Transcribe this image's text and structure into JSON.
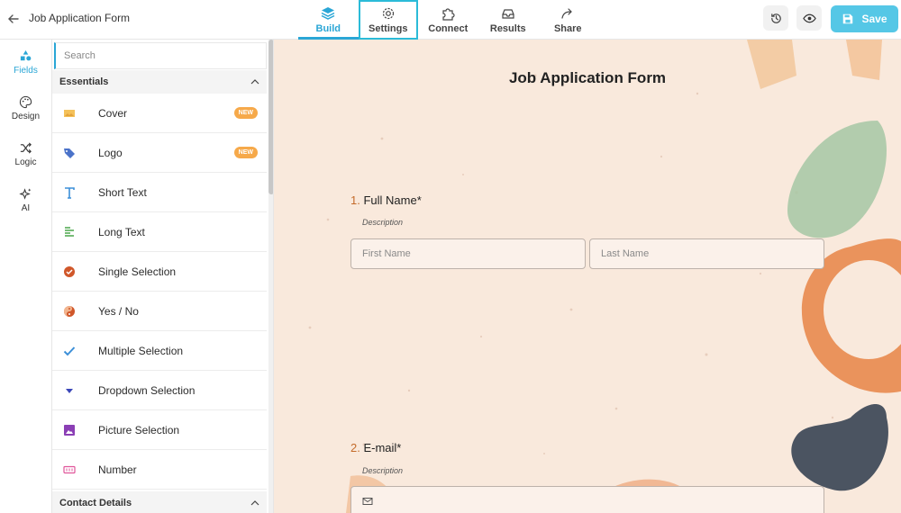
{
  "header": {
    "title": "Job Application Form",
    "tabs": [
      {
        "label": "Build",
        "icon": "layers-icon"
      },
      {
        "label": "Settings",
        "icon": "gear-icon"
      },
      {
        "label": "Connect",
        "icon": "puzzle-icon"
      },
      {
        "label": "Results",
        "icon": "inbox-icon"
      },
      {
        "label": "Share",
        "icon": "share-icon"
      }
    ],
    "save_label": "Save",
    "accent": "#2aa6d6",
    "save_color": "#55c7e6"
  },
  "rail": [
    {
      "label": "Fields",
      "icon": "shapes-icon"
    },
    {
      "label": "Design",
      "icon": "palette-icon"
    },
    {
      "label": "Logic",
      "icon": "shuffle-icon"
    },
    {
      "label": "AI",
      "icon": "sparkle-icon"
    }
  ],
  "panel": {
    "search_placeholder": "Search",
    "section_essentials": "Essentials",
    "section_contact": "Contact Details",
    "items": [
      {
        "label": "Cover",
        "badge": "NEW",
        "icon": "image-icon"
      },
      {
        "label": "Logo",
        "badge": "NEW",
        "icon": "tag-icon"
      },
      {
        "label": "Short Text",
        "icon": "text-icon"
      },
      {
        "label": "Long Text",
        "icon": "paragraph-icon"
      },
      {
        "label": "Single Selection",
        "icon": "check-circle-icon"
      },
      {
        "label": "Yes / No",
        "icon": "yes-no-icon"
      },
      {
        "label": "Multiple Selection",
        "icon": "checkmark-icon"
      },
      {
        "label": "Dropdown Selection",
        "icon": "caret-down-icon"
      },
      {
        "label": "Picture Selection",
        "icon": "picture-icon"
      },
      {
        "label": "Number",
        "icon": "number-icon"
      }
    ]
  },
  "form": {
    "title": "Job Application Form",
    "questions": [
      {
        "number": "1.",
        "label": "Full Name*",
        "description": "Description",
        "fields": [
          "First Name",
          "Last Name"
        ]
      },
      {
        "number": "2.",
        "label": "E-mail*",
        "description": "Description"
      }
    ]
  }
}
